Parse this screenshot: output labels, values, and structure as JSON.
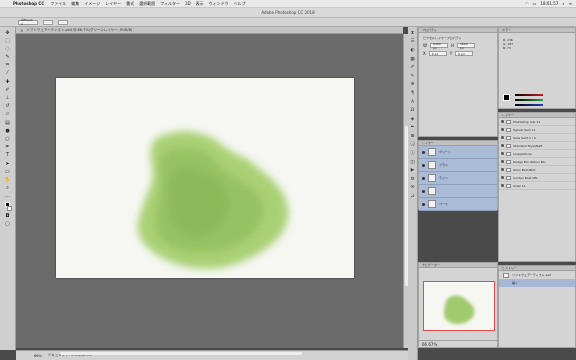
{
  "menubar": {
    "app": "Photoshop CC",
    "items": [
      "ファイル",
      "編集",
      "イメージ",
      "レイヤー",
      "書式",
      "選択範囲",
      "フィルター",
      "3D",
      "表示",
      "ウィンドウ",
      "ヘルプ"
    ],
    "clock": "18:01:57"
  },
  "app_title": "Adobe Photoshop CC 2018",
  "options_bar": {
    "field1": "Gftbook A",
    "field2": "",
    "field3": ""
  },
  "document_tab": "ソフトウェアーティスト.psd @ 66.7%(グリーンレイヤー, RGB/8)",
  "status": {
    "zoom": "66%",
    "doc": "ドキュメント: 2.6M/12.3M"
  },
  "properties": {
    "title": "プロパティ",
    "subtitle": "ピクセルレイヤープロパティ",
    "w_label": "W",
    "h_label": "H",
    "w_value": "2400 px",
    "h_value": "1600 px",
    "x_value": "0 px",
    "y_value": "0 px"
  },
  "color_panel": {
    "title": "カラー",
    "info": [
      "R: 136",
      "G: 187",
      "B: 73"
    ],
    "sliders": [
      "#c81f1f",
      "#2e9c39",
      "#2540c2"
    ]
  },
  "layers_mid": {
    "tab": "レイヤー",
    "rows": [
      "グリーン",
      "ブラシ",
      "ライン",
      "",
      "ベース"
    ]
  },
  "layers_right": {
    "title": "レイヤー",
    "rows": [
      "Photoshop Adv 11",
      "Typical Sem 11",
      "Sans Serif 1 / S",
      "Standard Style/Neft",
      "Looppletone",
      "Dodge Brn Obbon Blu",
      "Glinn Bold BLD",
      "Conten Bold VEL",
      "Cider 11"
    ]
  },
  "navigator": {
    "title": "ナビゲーター",
    "zoom": "66.67%"
  },
  "history": {
    "title": "ヒストリー",
    "items": [
      "ソフトウェアーティスト.psd",
      "開く"
    ]
  },
  "colors": {
    "canvas_bg": "#6b6b6b",
    "brush_green": "#8cbf4d",
    "selection": "#a6b8d5",
    "nav_frame": "#e34c4c"
  },
  "icons": {
    "apple": "apple-icon",
    "wifi": "wifi-icon",
    "battery": "battery-icon",
    "search": "search-icon"
  }
}
